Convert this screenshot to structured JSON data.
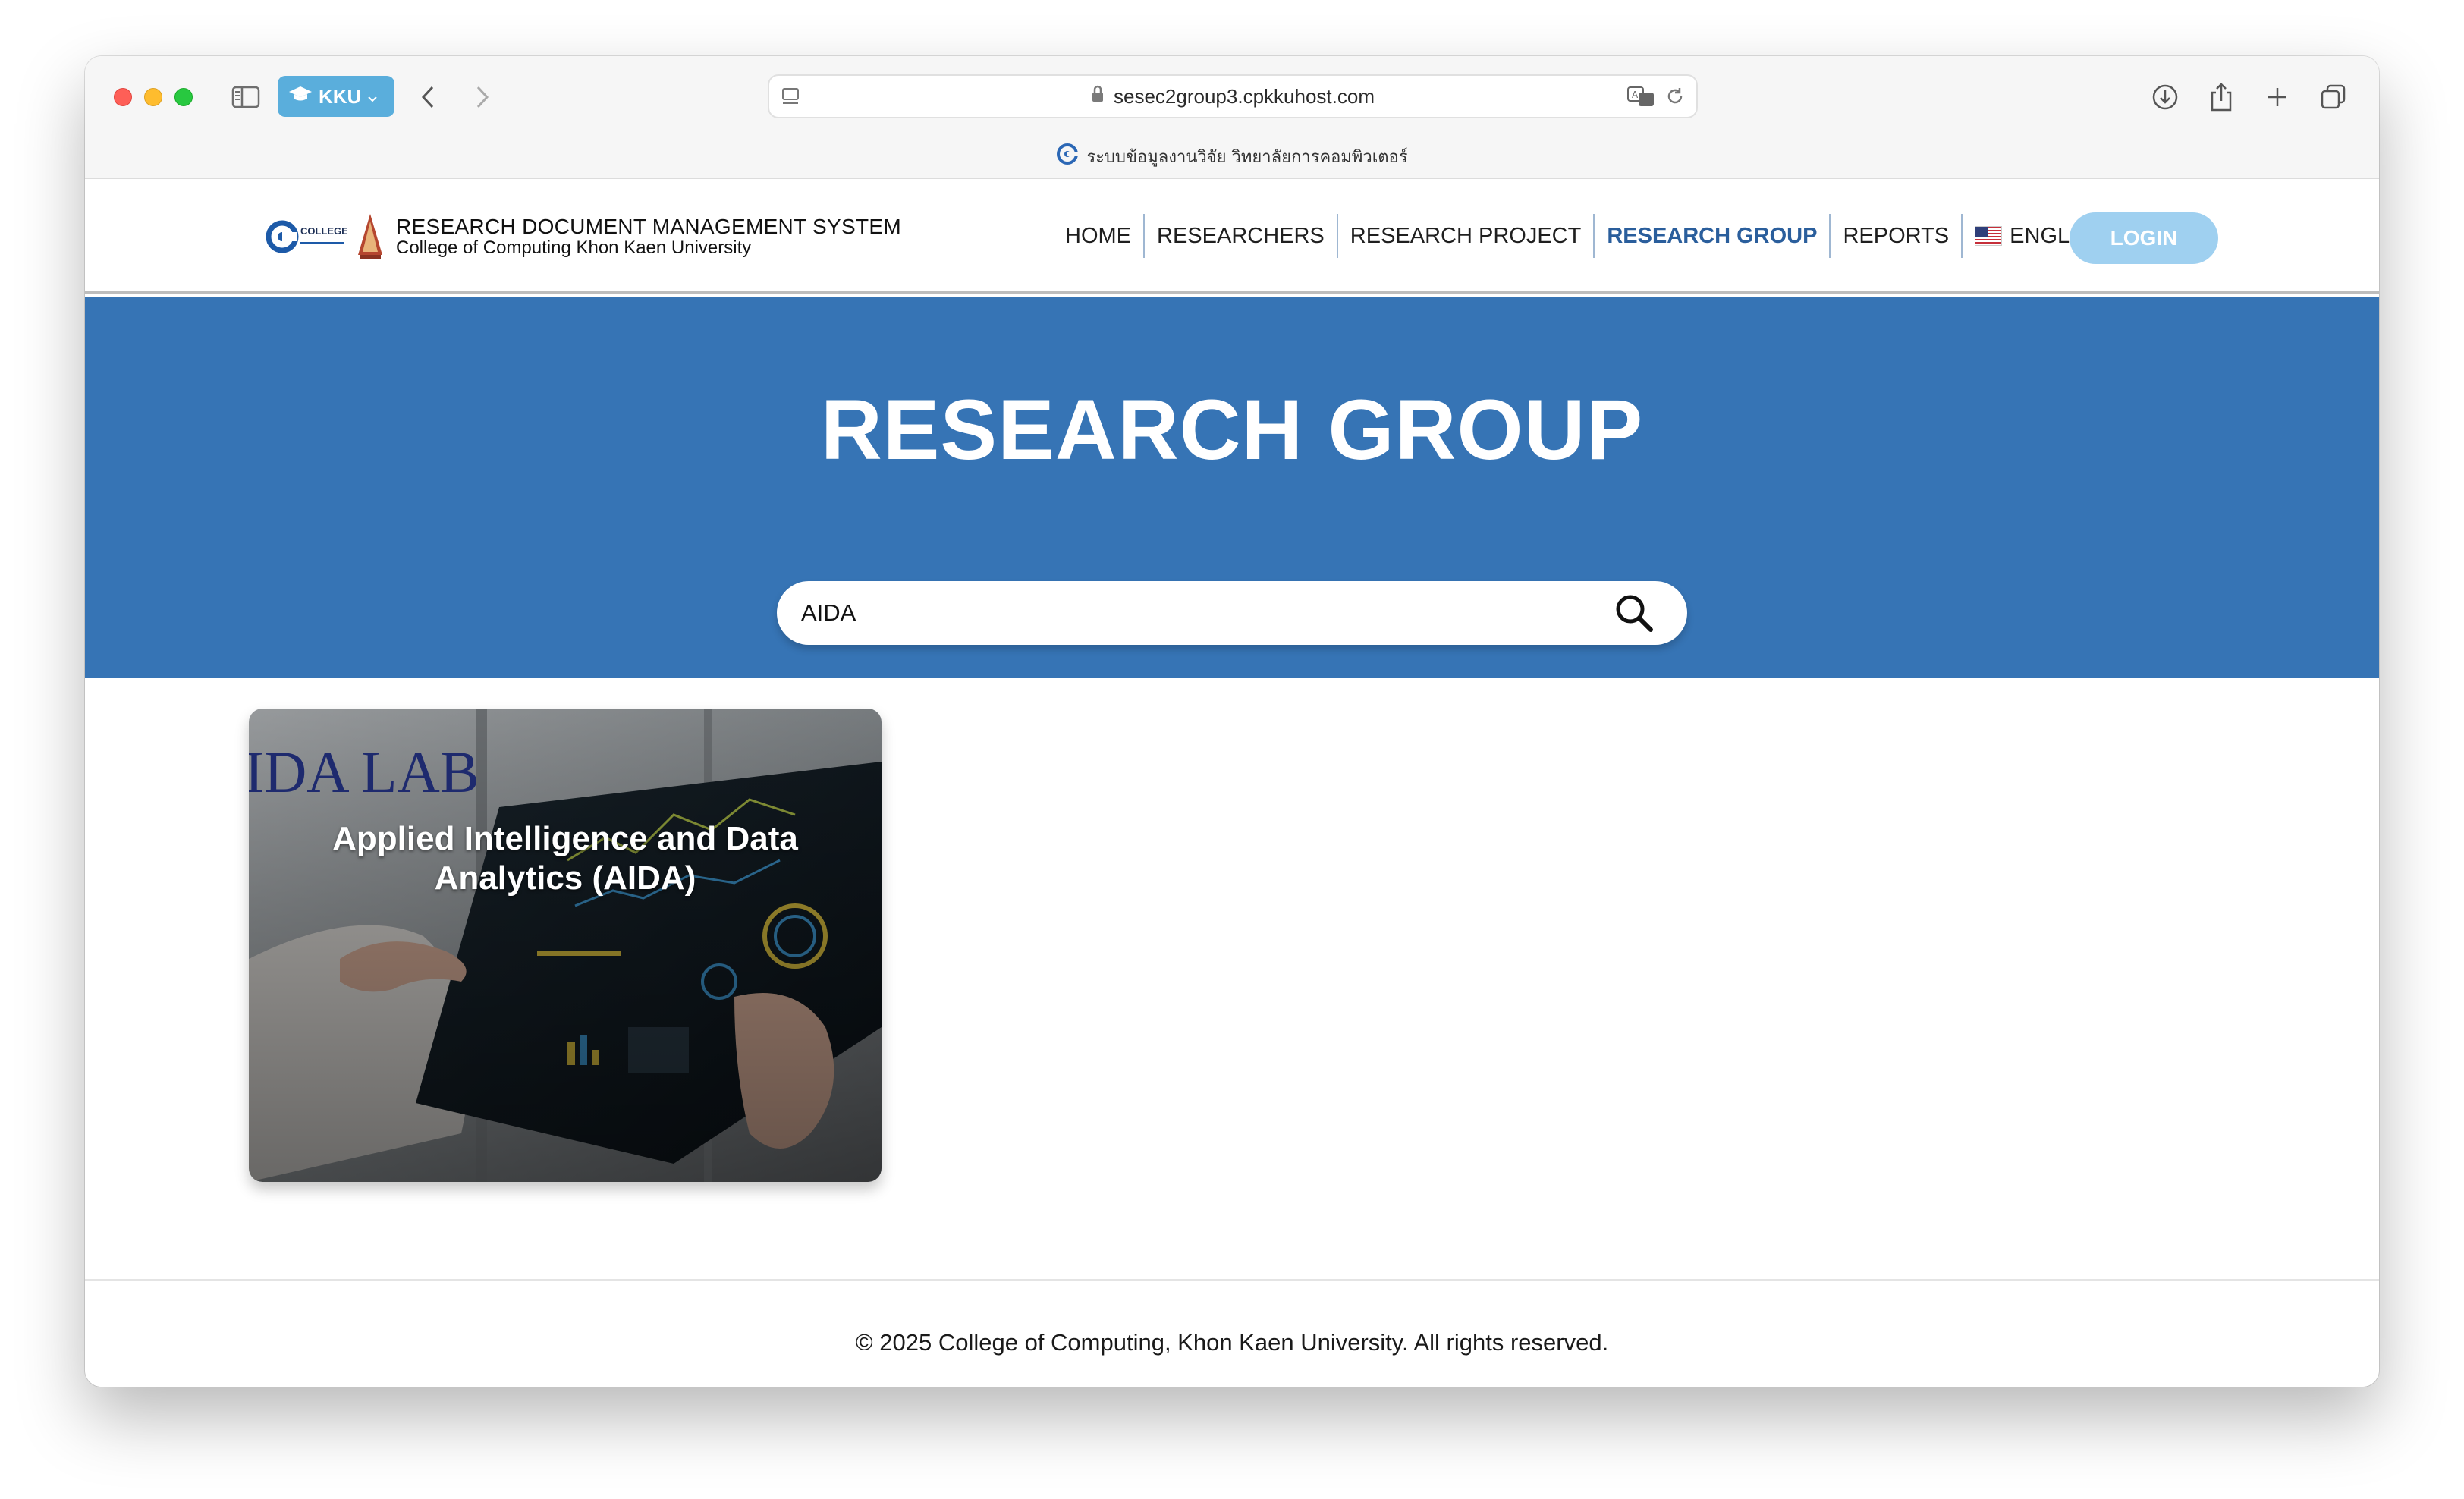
{
  "browser": {
    "tab_group_label": "KKU",
    "url": "sesec2group3.cpkkuhost.com",
    "page_subtitle": "ระบบข้อมูลงานวิจัย วิทยาลัยการคอมพิวเตอร์"
  },
  "header": {
    "logo_text": "COLLEGE OF COMPUTING",
    "brand_title": "RESEARCH DOCUMENT MANAGEMENT SYSTEM",
    "brand_subtitle": "College of Computing Khon Kaen University",
    "nav": [
      {
        "label": "HOME",
        "active": false
      },
      {
        "label": "RESEARCHERS",
        "active": false
      },
      {
        "label": "RESEARCH PROJECT",
        "active": false
      },
      {
        "label": "RESEARCH GROUP",
        "active": true
      },
      {
        "label": "REPORTS",
        "active": false
      }
    ],
    "language": "ENGLISH",
    "login_label": "LOGIN"
  },
  "hero": {
    "title": "RESEARCH GROUP",
    "search_value": "AIDA"
  },
  "cards": [
    {
      "image_text": "IDA LAB",
      "title": "Applied Intelligence and Data Analytics (AIDA)"
    }
  ],
  "footer": {
    "copyright": "© 2025 College of Computing, Khon Kaen University. All rights reserved."
  },
  "colors": {
    "hero_bg": "#3674b5",
    "active_nav": "#2a5e9c",
    "login_bg": "#9fd0f0",
    "tab_group_bg": "#5aaedc"
  },
  "icons": [
    "sidebar-icon",
    "graduation-cap-icon",
    "chevron-left-icon",
    "chevron-right-icon",
    "lock-icon",
    "translate-icon",
    "reload-icon",
    "download-icon",
    "share-icon",
    "plus-icon",
    "tabs-overview-icon",
    "search-icon",
    "us-flag-icon"
  ]
}
